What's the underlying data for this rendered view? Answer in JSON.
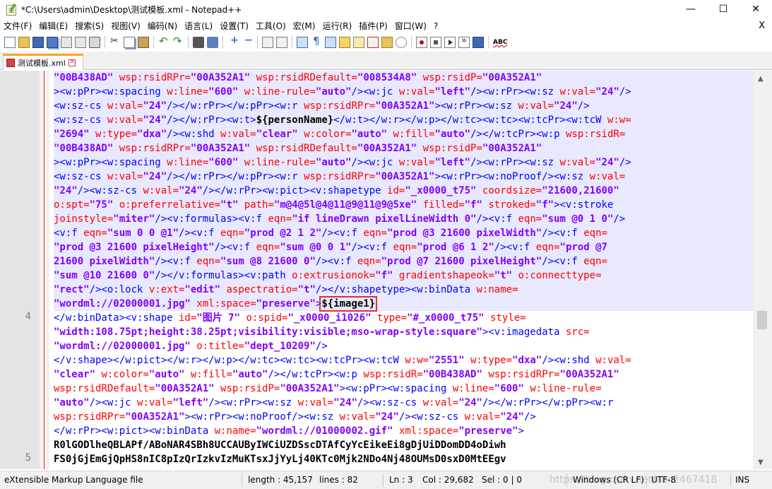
{
  "window": {
    "title": "*C:\\Users\\admin\\Desktop\\测试模板.xml - Notepad++",
    "minimize": "—",
    "maximize": "☐",
    "close": "✕"
  },
  "menu": {
    "items": [
      "文件(F)",
      "编辑(E)",
      "搜索(S)",
      "视图(V)",
      "编码(N)",
      "语言(L)",
      "设置(T)",
      "工具(O)",
      "宏(M)",
      "运行(R)",
      "插件(P)",
      "窗口(W)",
      "?"
    ],
    "close_x": "X"
  },
  "toolbar": {
    "spell_label": "ABC"
  },
  "tab": {
    "label": "测试模板.xml"
  },
  "gutter": {
    "line4": "4",
    "line5": "5"
  },
  "code": {
    "l1": {
      "a": "\"00B438AD\"",
      "b": " wsp:rsidRPr=",
      "c": "\"00A352A1\"",
      "d": " wsp:rsidRDefault=",
      "e": "\"008534A8\"",
      "f": " wsp:rsidP=",
      "g": "\"00A352A1\""
    },
    "l2": {
      "a": "><w:pPr><w:spacing",
      "b": " w:line=",
      "c": "\"600\"",
      "d": " w:line-rule=",
      "e": "\"auto\"",
      "f": "/><w:jc",
      "g": " w:val=",
      "h": "\"left\"",
      "i": "/><w:rPr><w:sz",
      "j": " w:val=",
      "k": "\"24\"",
      "l": "/>"
    },
    "l3": {
      "a": "<w:sz-cs",
      "b": " w:val=",
      "c": "\"24\"",
      "d": "/></w:rPr></w:pPr><w:r",
      "e": " wsp:rsidRPr=",
      "f": "\"00A352A1\"",
      "g": "><w:rPr><w:sz",
      "h": " w:val=",
      "i": "\"24\"",
      "j": "/>"
    },
    "l4": {
      "a": "<w:sz-cs",
      "b": " w:val=",
      "c": "\"24\"",
      "d": "/></w:rPr><w:t>",
      "e": "${personName}",
      "f": "</w:t></w:r></w:p></w:tc><w:tc><w:tcPr><w:tcW",
      "g": " w:w="
    },
    "l5": {
      "a": "\"2694\"",
      "b": " w:type=",
      "c": "\"dxa\"",
      "d": "/><w:shd",
      "e": " w:val=",
      "f": "\"clear\"",
      "g": " w:color=",
      "h": "\"auto\"",
      "i": " w:fill=",
      "j": "\"auto\"",
      "k": "/></w:tcPr><w:p",
      "l": " wsp:rsidR="
    },
    "l6": {
      "a": "\"00B438AD\"",
      "b": " wsp:rsidRPr=",
      "c": "\"00A352A1\"",
      "d": " wsp:rsidRDefault=",
      "e": "\"00A352A1\"",
      "f": " wsp:rsidP=",
      "g": "\"00A352A1\""
    },
    "l7": {
      "a": "><w:pPr><w:spacing",
      "b": " w:line=",
      "c": "\"600\"",
      "d": " w:line-rule=",
      "e": "\"auto\"",
      "f": "/><w:jc",
      "g": " w:val=",
      "h": "\"left\"",
      "i": "/><w:rPr><w:sz",
      "j": " w:val=",
      "k": "\"24\"",
      "l": "/>"
    },
    "l8": {
      "a": "<w:sz-cs",
      "b": " w:val=",
      "c": "\"24\"",
      "d": "/></w:rPr></w:pPr><w:r",
      "e": " wsp:rsidRPr=",
      "f": "\"00A352A1\"",
      "g": "><w:rPr><w:noProof/><w:sz",
      "h": " w:val="
    },
    "l9": {
      "a": "\"24\"",
      "b": "/><w:sz-cs",
      "c": " w:val=",
      "d": "\"24\"",
      "e": "/></w:rPr><w:pict><v:shapetype",
      "f": " id=",
      "g": "\"_x0000_t75\"",
      "h": " coordsize=",
      "i": "\"21600,21600\""
    },
    "l10": {
      "a": "o:spt=",
      "b": "\"75\"",
      "c": " o:preferrelative=",
      "d": "\"t\"",
      "e": " path=",
      "f": "\"m@4@5l@4@11@9@11@9@5xe\"",
      "g": " filled=",
      "h": "\"f\"",
      "i": " stroked=",
      "j": "\"f\"",
      "k": "><v:stroke"
    },
    "l11": {
      "a": "joinstyle=",
      "b": "\"miter\"",
      "c": "/><v:formulas><v:f",
      "d": " eqn=",
      "e": "\"if lineDrawn pixelLineWidth 0\"",
      "f": "/><v:f",
      "g": " eqn=",
      "h": "\"sum @0 1 0\"",
      "i": "/>"
    },
    "l12": {
      "a": "<v:f",
      "b": " eqn=",
      "c": "\"sum 0 0 @1\"",
      "d": "/><v:f",
      "e": " eqn=",
      "f": "\"prod @2 1 2\"",
      "g": "/><v:f",
      "h": " eqn=",
      "i": "\"prod @3 21600 pixelWidth\"",
      "j": "/><v:f",
      "k": " eqn="
    },
    "l13": {
      "a": "\"prod @3 21600 pixelHeight\"",
      "b": "/><v:f",
      "c": " eqn=",
      "d": "\"sum @0 0 1\"",
      "e": "/><v:f",
      "f": " eqn=",
      "g": "\"prod @6 1 2\"",
      "h": "/><v:f",
      "i": " eqn=",
      "j": "\"prod @7"
    },
    "l14": {
      "a": "21600 pixelWidth\"",
      "b": "/><v:f",
      "c": " eqn=",
      "d": "\"sum @8 21600 0\"",
      "e": "/><v:f",
      "f": " eqn=",
      "g": "\"prod @7 21600 pixelHeight\"",
      "h": "/><v:f",
      "i": " eqn="
    },
    "l15": {
      "a": "\"sum @10 21600 0\"",
      "b": "/></v:formulas><v:path",
      "c": " o:extrusionok=",
      "d": "\"f\"",
      "e": " gradientshapeok=",
      "f": "\"t\"",
      "g": " o:connecttype="
    },
    "l16": {
      "a": "\"rect\"",
      "b": "/><o:lock",
      "c": " v:ext=",
      "d": "\"edit\"",
      "e": " aspectratio=",
      "f": "\"t\"",
      "g": "/></v:shapetype><w:binData",
      "h": " w:name="
    },
    "l17": {
      "a": "\"wordml://02000001.jpg\"",
      "b": " xml:space=",
      "c": "\"preserve\"",
      "d": ">",
      "e": "${image1}"
    },
    "l18": {
      "a": "</w:binData><v:shape",
      "b": " id=",
      "c": "\"图片 7\"",
      "d": " o:spid=",
      "e": "\"_x0000_i1026\"",
      "f": " type=",
      "g": "\"#_x0000_t75\"",
      "h": " style="
    },
    "l19": {
      "a": "\"width:108.75pt;height:38.25pt;visibility:visible;mso-wrap-style:square\"",
      "b": "><v:imagedata",
      "c": " src="
    },
    "l20": {
      "a": "\"wordml://02000001.jpg\"",
      "b": " o:title=",
      "c": "\"dept_10209\"",
      "d": "/>"
    },
    "l21": {
      "a": "</v:shape></w:pict></w:r></w:p></w:tc><w:tc><w:tcPr><w:tcW",
      "b": " w:w=",
      "c": "\"2551\"",
      "d": " w:type=",
      "e": "\"dxa\"",
      "f": "/><w:shd",
      "g": " w:val="
    },
    "l22": {
      "a": "\"clear\"",
      "b": " w:color=",
      "c": "\"auto\"",
      "d": " w:fill=",
      "e": "\"auto\"",
      "f": "/></w:tcPr><w:p",
      "g": " wsp:rsidR=",
      "h": "\"00B438AD\"",
      "i": " wsp:rsidRPr=",
      "j": "\"00A352A1\""
    },
    "l23": {
      "a": "wsp:rsidRDefault=",
      "b": "\"00A352A1\"",
      "c": " wsp:rsidP=",
      "d": "\"00A352A1\"",
      "e": "><w:pPr><w:spacing",
      "f": " w:line=",
      "g": "\"600\"",
      "h": " w:line-rule="
    },
    "l24": {
      "a": "\"auto\"",
      "b": "/><w:jc",
      "c": " w:val=",
      "d": "\"left\"",
      "e": "/><w:rPr><w:sz",
      "f": " w:val=",
      "g": "\"24\"",
      "h": "/><w:sz-cs",
      "i": " w:val=",
      "j": "\"24\"",
      "k": "/></w:rPr></w:pPr><w:r"
    },
    "l25": {
      "a": "wsp:rsidRPr=",
      "b": "\"00A352A1\"",
      "c": "><w:rPr><w:noProof/><w:sz",
      "d": " w:val=",
      "e": "\"24\"",
      "f": "/><w:sz-cs",
      "g": " w:val=",
      "h": "\"24\"",
      "i": "/>"
    },
    "l26": {
      "a": "</w:rPr><w:pict><w:binData",
      "b": " w:name=",
      "c": "\"wordml://01000002.gif\"",
      "d": " xml:space=",
      "e": "\"preserve\"",
      "f": ">"
    },
    "l27": {
      "a": "R0lGODlheQBLAPf/ABoNAR4SBh8UCCAUByIWCiUZDSscDTAfCyYcEikeEi8gDjUiDDomDD4oDiwh"
    },
    "l28": {
      "a": "FS0jGjEmGjQpHS8nIC8pIzQrIzkvIzMuKTsxJjYyLj40KTc0Mjk2NDo4Nj48OUMsD0sxD0MtEEgv"
    }
  },
  "status": {
    "language": "eXtensible Markup Language file",
    "length": "length : 45,157",
    "lines": "lines : 82",
    "ln": "Ln : 3",
    "col": "Col : 29,682",
    "sel": "Sel : 0 | 0",
    "eol": "Windows (CR LF)",
    "encoding": "UTF-8",
    "ins": "INS",
    "watermark": "https://blog.csdn.net/abc2467418"
  },
  "colors": {
    "tag": "#0000ff",
    "attr": "#ff0000",
    "value": "#8000ff",
    "highlight": "#e8e8ff",
    "tab_accent": "#f5a623",
    "callout_box": "#e03030"
  }
}
